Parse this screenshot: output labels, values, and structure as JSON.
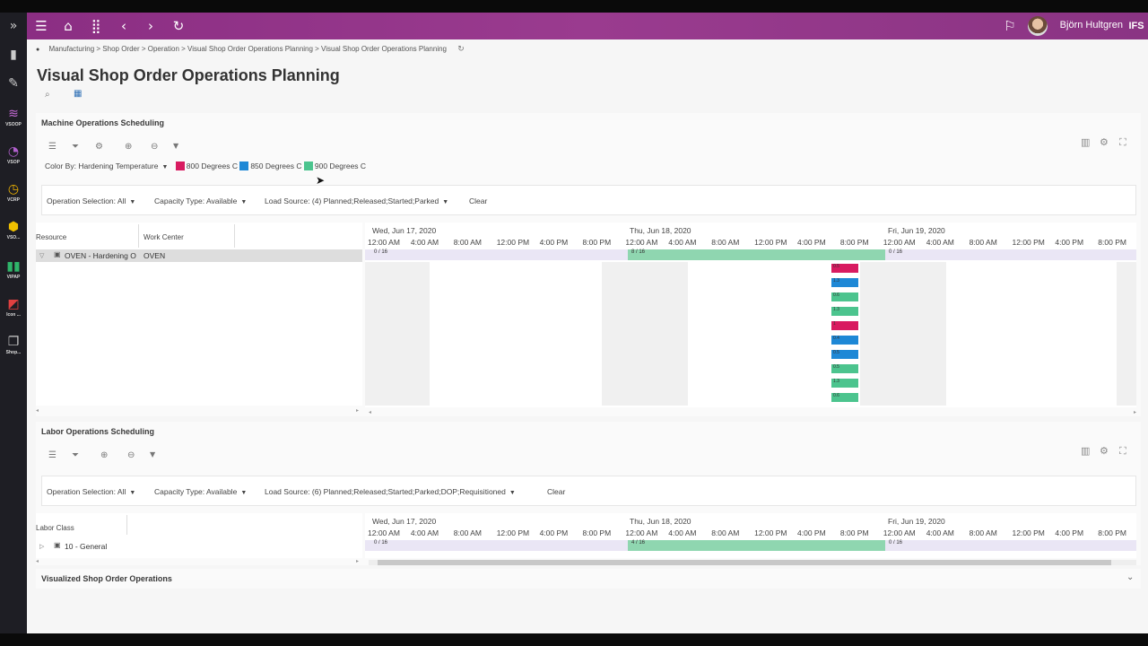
{
  "header": {
    "user_name": "Björn Hultgren",
    "logo": "IFS",
    "icons": [
      "menu-icon",
      "home-icon",
      "apps-grid-icon",
      "back-icon",
      "forward-icon",
      "refresh-icon",
      "notifications-icon"
    ]
  },
  "rail": {
    "items": [
      {
        "label": "VSOOP",
        "icon": "layers-icon",
        "color": "#c56bd6"
      },
      {
        "label": "VSOP",
        "icon": "pie-icon",
        "color": "#b05fcc"
      },
      {
        "label": "VCRP",
        "icon": "clock-icon",
        "color": "#f0b400"
      },
      {
        "label": "VSO...",
        "icon": "cube-icon",
        "color": "#f0c000"
      },
      {
        "label": "VIPAP",
        "icon": "bars-icon",
        "color": "#2fb56a"
      },
      {
        "label": "Icon ...",
        "icon": "chart-icon",
        "color": "#e04040"
      },
      {
        "label": "Shop...",
        "icon": "pages-icon",
        "color": "#cccccc"
      }
    ]
  },
  "breadcrumb": "Manufacturing > Shop Order > Operation > Visual Shop Order Operations Planning > Visual Shop Order Operations Planning",
  "page_title": "Visual Shop Order Operations Planning",
  "machine": {
    "title": "Machine Operations Scheduling",
    "color_by": "Color By: Hardening Temperature",
    "legend": [
      {
        "label": "800 Degrees C",
        "color": "#d81b60"
      },
      {
        "label": "850 Degrees C",
        "color": "#1e88d6"
      },
      {
        "label": "900 Degrees C",
        "color": "#4cc48e"
      }
    ],
    "filters": {
      "operation_selection": "Operation Selection: All",
      "capacity_type": "Capacity Type: Available",
      "load_source": "Load Source: (4) Planned;Released;Started;Parked",
      "clear": "Clear"
    },
    "col_resource": "Resource",
    "col_work_center": "Work Center",
    "row_resource": "OVEN - Hardening O",
    "row_work_center": "OVEN",
    "load_labels": [
      "0 / 16",
      "8 / 16",
      "0 / 16"
    ],
    "ops": [
      {
        "label": "0.5",
        "temp": "800"
      },
      {
        "label": "1.3",
        "temp": "850"
      },
      {
        "label": "0.6",
        "temp": "900"
      },
      {
        "label": "1.3",
        "temp": "900"
      },
      {
        "label": "1",
        "temp": "800"
      },
      {
        "label": "0.4",
        "temp": "850"
      },
      {
        "label": "0.5",
        "temp": "850"
      },
      {
        "label": "0.5",
        "temp": "900"
      },
      {
        "label": "1.3",
        "temp": "900"
      },
      {
        "label": "0.6",
        "temp": "900"
      }
    ]
  },
  "dates": [
    "Wed, Jun 17, 2020",
    "Thu, Jun 18, 2020",
    "Fri, Jun 19, 2020"
  ],
  "hours": [
    "12:00 AM",
    "4:00 AM",
    "8:00 AM",
    "12:00 PM",
    "4:00 PM",
    "8:00 PM",
    "12:00 AM",
    "4:00 AM",
    "8:00 AM",
    "12:00 PM",
    "4:00 PM",
    "8:00 PM",
    "12:00 AM",
    "4:00 AM",
    "8:00 AM",
    "12:00 PM",
    "4:00 PM",
    "8:00 PM"
  ],
  "labor": {
    "title": "Labor Operations Scheduling",
    "filters": {
      "operation_selection": "Operation Selection: All",
      "capacity_type": "Capacity Type: Available",
      "load_source": "Load Source: (6) Planned;Released;Started;Parked;DOP;Requisitioned",
      "clear": "Clear"
    },
    "col_labor_class": "Labor Class",
    "row_label": "10 - General",
    "load_labels": [
      "0 / 16",
      "4 / 16",
      "0 / 16"
    ]
  },
  "visualized": {
    "title": "Visualized Shop Order Operations"
  }
}
